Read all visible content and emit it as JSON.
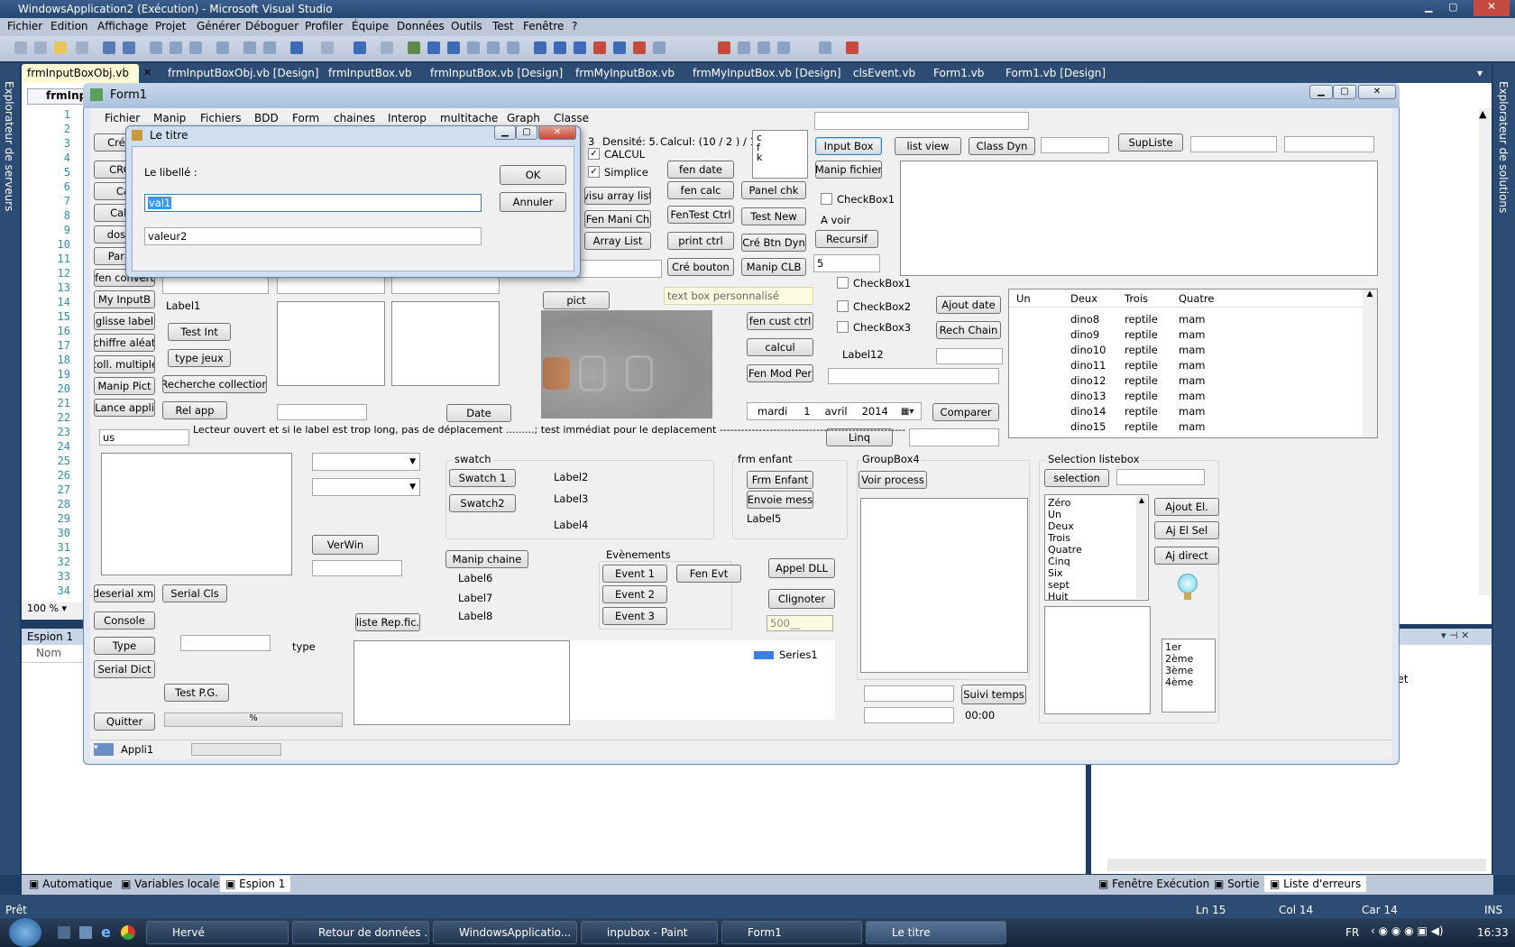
{
  "vs": {
    "title": "WindowsApplication2 (Exécution) - Microsoft Visual Studio",
    "menu": [
      "Fichier",
      "Edition",
      "Affichage",
      "Projet",
      "Générer",
      "Déboguer",
      "Profiler",
      "Équipe",
      "Données",
      "Outils",
      "Test",
      "Fenêtre",
      "?"
    ],
    "tabs": [
      "frmInputBoxObj.vb",
      "frmInputBoxObj.vb [Design]",
      "frmInputBox.vb",
      "frmInputBox.vb [Design]",
      "frmMyInputBox.vb",
      "frmMyInputBox.vb [Design]",
      "clsEvent.vb",
      "Form1.vb",
      "Form1.vb [Design]"
    ],
    "left_strip": "Explorateur de serveurs",
    "right_strip": "Explorateur de solutions",
    "editor_tab": "frmInpu",
    "line_numbers": [
      "1",
      "2",
      "3",
      "4",
      "5",
      "6",
      "7",
      "8",
      "9",
      "10",
      "11",
      "12",
      "13",
      "14",
      "15",
      "16",
      "17",
      "18",
      "19",
      "20",
      "21",
      "22",
      "23",
      "24",
      "25",
      "26",
      "27",
      "28",
      "29",
      "30",
      "31",
      "32",
      "33",
      "34"
    ],
    "zoom": "100 %",
    "espion_title": "Espion 1",
    "espion_col": "Nom",
    "bottom_tabs_left": [
      "Automatique",
      "Variables locales",
      "Espion 1"
    ],
    "bottom_tabs_right": [
      "Fenêtre Exécution",
      "Sortie",
      "Liste d'erreurs"
    ],
    "right_panel_label": "jet",
    "status": {
      "ready": "Prêt",
      "ln": "Ln 15",
      "col": "Col 14",
      "car": "Car 14",
      "ins": "INS"
    }
  },
  "taskbar": {
    "items": [
      "Hervé",
      "Retour de données ...",
      "WindowsApplicatio...",
      "inpubox - Paint",
      "Form1",
      "Le titre"
    ],
    "lang": "FR",
    "clock": "16:33"
  },
  "form1": {
    "title": "Form1",
    "menu": [
      "Fichier",
      "Manip",
      "Fichiers",
      "BDD",
      "Form",
      "chaines",
      "Interop",
      "multitache",
      "Graph",
      "Classe"
    ],
    "left_buttons": [
      "Cré nu",
      "CRC F",
      "Cal",
      "Cal M",
      "dos.mi",
      "Param",
      "fen convert",
      "My InputB",
      "glisse label",
      "chiffre aléat",
      "coll. multiple",
      "Manip Pict",
      "Lance appli"
    ],
    "buttons": {
      "test_int": "Test Int",
      "type_jeux": "type jeux",
      "recherche": "Recherche collection",
      "rel_app": "Rel app",
      "date": "Date",
      "pict": "pict",
      "visu_array": "visu array list",
      "fen_mani": "Fen Mani Ch",
      "array_list": "Array List",
      "fen_date": "fen date",
      "fen_calc": "fen calc",
      "fentest": "FenTest Ctrl",
      "print_ctrl": "print ctrl",
      "cre_bouton": "Cré bouton",
      "panel_chk": "Panel chk",
      "test_new": "Test New",
      "cre_btn_dyn": "Cré Btn Dyn",
      "manip_clb": "Manip CLB",
      "input_box": "Input Box",
      "manip_fichier": "Manip fichier",
      "recursif": "Recursif",
      "list_view": "list view",
      "class_dyn": "Class Dyn",
      "supliste": "SupListe",
      "ajout_date": "Ajout date",
      "rech_chain": "Rech Chain",
      "fen_cust": "fen cust ctrl",
      "calcul": "calcul",
      "fen_mod_per": "Fen Mod Per",
      "comparer": "Comparer",
      "linq": "Linq",
      "swatch1": "Swatch 1",
      "swatch2": "Swatch2",
      "verwin": "VerWin",
      "manip_chaine": "Manip chaine",
      "event1": "Event 1",
      "event2": "Event 2",
      "event3": "Event 3",
      "fen_evt": "Fen Evt",
      "frm_enfant": "Frm Enfant",
      "envoie_mess": "Envoie mess",
      "appel_dll": "Appel DLL",
      "clignoter": "Clignoter",
      "voir_process": "Voir process",
      "suivi_temps": "Suivi temps",
      "selection": "selection",
      "ajout_el": "Ajout El.",
      "aj_el_sel": "Aj El Sel",
      "aj_direct": "Aj direct",
      "deserial": "deserial xml",
      "serial_cls": "Serial Cls",
      "console": "Console",
      "type": "Type",
      "serial_dict": "Serial Dict",
      "liste_rep": "liste Rep.fic.",
      "test_pg": "Test P.G.",
      "quitter": "Quitter"
    },
    "labels": {
      "densite": "Densité: 5.",
      "calcul": "Calcul: (10 / 2 ) / 1",
      "calcul_chk": "CALCUL",
      "simplice_chk": "Simplice",
      "label1": "Label1",
      "label12": "Label12",
      "a_voir": "A voir",
      "checkbox1a": "CheckBox1",
      "checkbox1b": "CheckBox1",
      "checkbox2": "CheckBox2",
      "checkbox3": "CheckBox3",
      "lecteur": "Lecteur ouvert et si le label est trop long, pas de déplacement .........; test immédiat pour le deplacement ----------------------------------------------------",
      "swatch": "swatch",
      "label2": "Label2",
      "label3": "Label3",
      "label4": "Label4",
      "frm_enfant_grp": "frm enfant",
      "label5": "Label5",
      "groupbox4": "GroupBox4",
      "selection_listebox": "Selection listebox",
      "evenements": "Evènements",
      "label6": "Label6",
      "label7": "Label7",
      "label8": "Label8",
      "type_lbl": "type",
      "series1": "Series1",
      "time": "00:00",
      "appli1": "Appli1",
      "pct": "%",
      "digit": "3"
    },
    "textboxes": {
      "custom": "text box personnalisé",
      "five": "5",
      "us": "us",
      "masked": "500__"
    },
    "letters_list": [
      "c",
      "f",
      "k"
    ],
    "date_picker": {
      "day": "mardi",
      "num": "1",
      "month": "avril",
      "year": "2014"
    },
    "listview": {
      "columns": [
        "Un",
        "Deux",
        "Trois",
        "Quatre"
      ],
      "rows": [
        [
          "",
          "dino8",
          "reptile",
          "mam"
        ],
        [
          "",
          "dino9",
          "reptile",
          "mam"
        ],
        [
          "",
          "dino10",
          "reptile",
          "mam"
        ],
        [
          "",
          "dino11",
          "reptile",
          "mam"
        ],
        [
          "",
          "dino12",
          "reptile",
          "mam"
        ],
        [
          "",
          "dino13",
          "reptile",
          "mam"
        ],
        [
          "",
          "dino14",
          "reptile",
          "mam"
        ],
        [
          "",
          "dino15",
          "reptile",
          "mam"
        ]
      ]
    },
    "number_list": [
      "Zéro",
      "Un",
      "Deux",
      "Trois",
      "Quatre",
      "Cinq",
      "Six",
      "sept",
      "Huit"
    ],
    "rank_list": [
      "1er",
      "2ème",
      "3ème",
      "4ème"
    ]
  },
  "dialog": {
    "title": "Le titre",
    "label": "Le libellé :",
    "input_value": "val1",
    "input2_value": "valeur2",
    "ok": "OK",
    "cancel": "Annuler"
  }
}
